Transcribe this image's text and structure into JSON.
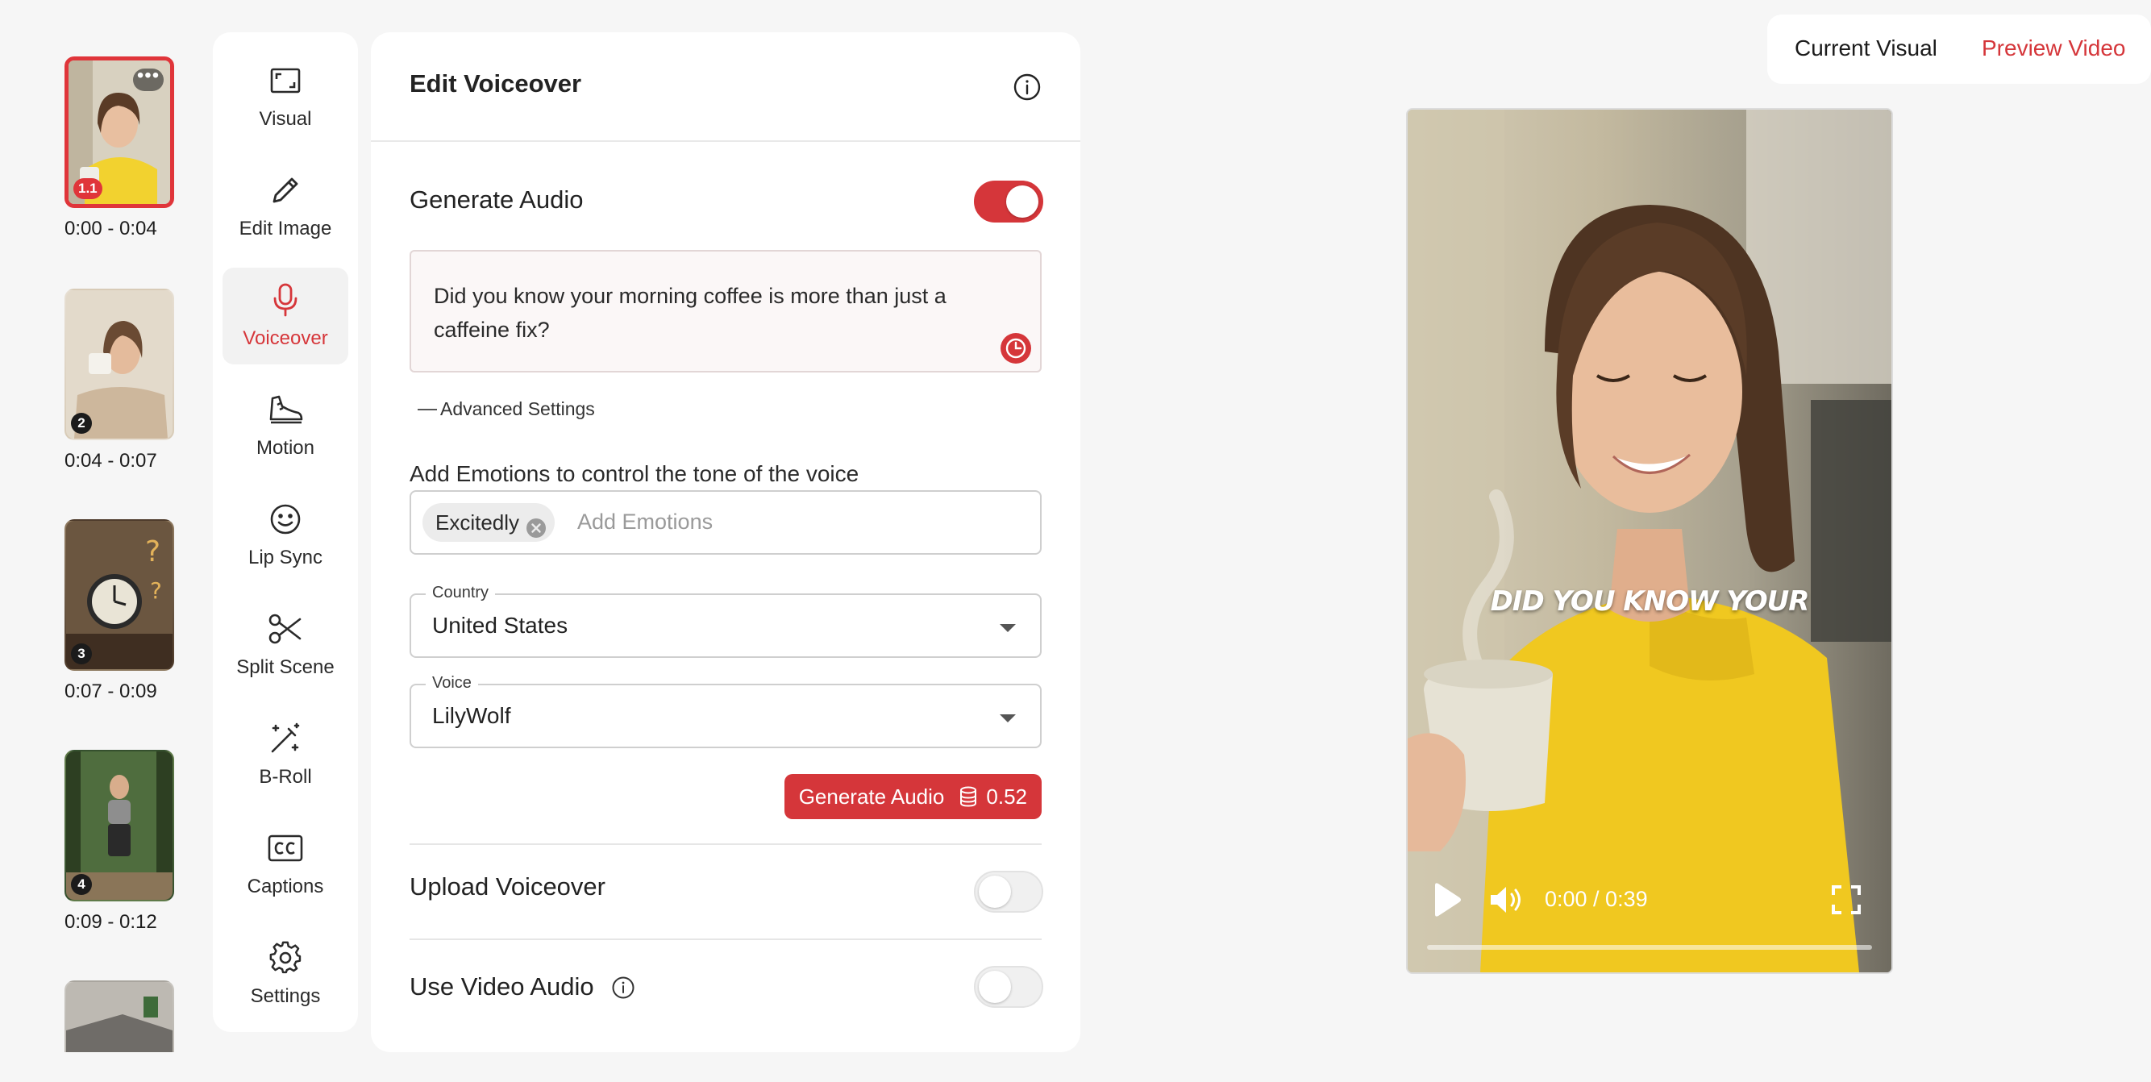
{
  "scenes": [
    {
      "number": "1.1",
      "time": "0:00 - 0:04",
      "more": "•••"
    },
    {
      "number": "2",
      "time": "0:04 - 0:07"
    },
    {
      "number": "3",
      "time": "0:07 - 0:09"
    },
    {
      "number": "4",
      "time": "0:09 - 0:12"
    },
    {
      "number": "",
      "time": ""
    }
  ],
  "tools": [
    {
      "label": "Visual",
      "icon": "visual-icon"
    },
    {
      "label": "Edit Image",
      "icon": "pencil-icon"
    },
    {
      "label": "Voiceover",
      "icon": "microphone-icon"
    },
    {
      "label": "Motion",
      "icon": "shoe-icon"
    },
    {
      "label": "Lip Sync",
      "icon": "smiley-icon"
    },
    {
      "label": "Split Scene",
      "icon": "scissors-icon"
    },
    {
      "label": "B-Roll",
      "icon": "magic-wand-icon"
    },
    {
      "label": "Captions",
      "icon": "cc-icon"
    },
    {
      "label": "Settings",
      "icon": "gear-icon"
    }
  ],
  "panel": {
    "title": "Edit Voiceover",
    "generate_audio": {
      "label": "Generate Audio",
      "enabled": true
    },
    "script_text": "Did you know your morning coffee is more than just a caffeine fix?",
    "advanced_label": "Advanced Settings",
    "emotions": {
      "label": "Add Emotions to control the tone of the voice",
      "chips": [
        "Excitedly"
      ],
      "placeholder": "Add Emotions"
    },
    "country": {
      "legend": "Country",
      "value": "United States"
    },
    "voice": {
      "legend": "Voice",
      "value": "LilyWolf"
    },
    "generate_button": {
      "label": "Generate Audio",
      "cost": "0.52"
    },
    "upload_voiceover": {
      "label": "Upload Voiceover",
      "enabled": false
    },
    "use_video_audio": {
      "label": "Use Video Audio",
      "enabled": false
    }
  },
  "view_tabs": {
    "current": "Current Visual",
    "preview": "Preview Video"
  },
  "video": {
    "caption": "DID YOU KNOW YOUR",
    "time": "0:00 / 0:39",
    "progress": 0
  },
  "colors": {
    "accent": "#d5363a",
    "panel_bg": "#ffffff",
    "page_bg": "#f6f6f6"
  }
}
